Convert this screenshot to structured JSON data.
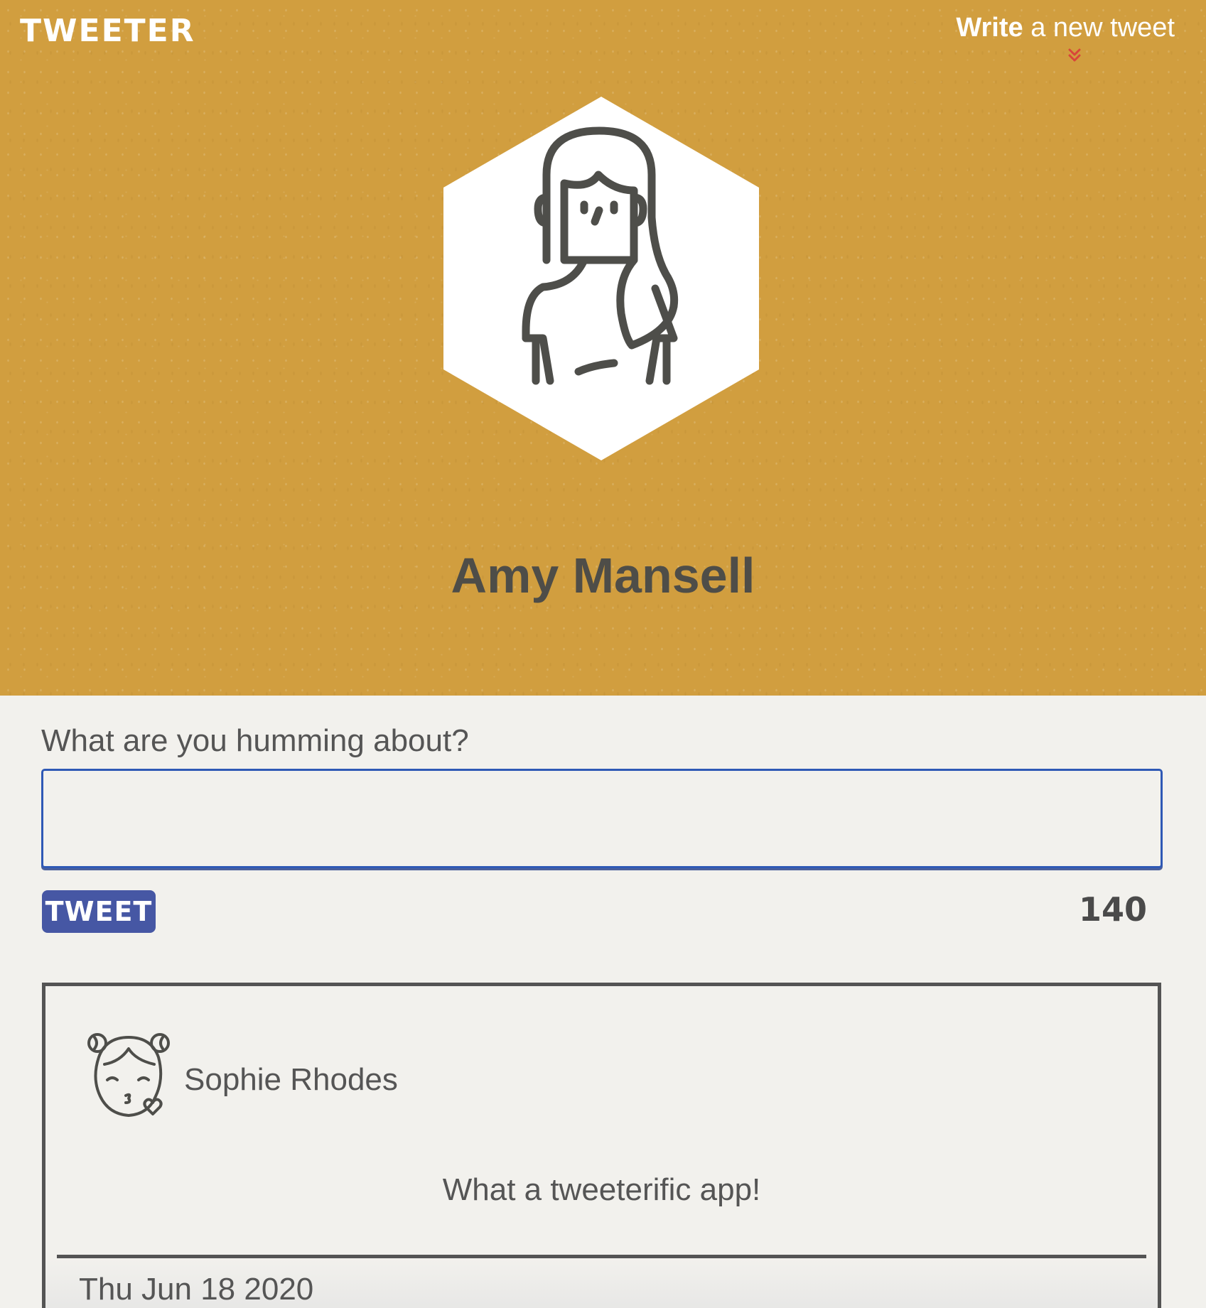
{
  "app": {
    "logo": "TWEETER"
  },
  "nav": {
    "compose_strong": "Write",
    "compose_rest": " a new tweet",
    "compose_icon": "chevron-double-down-icon"
  },
  "profile": {
    "name": "Amy Mansell",
    "avatar_icon": "woman-avatar-icon"
  },
  "compose": {
    "prompt": "What are you humming about?",
    "value": "",
    "button_label": "TWEET",
    "counter": "140"
  },
  "tweets": [
    {
      "author": "Sophie Rhodes",
      "avatar_icon": "girl-kissing-avatar-icon",
      "text": "What a tweeterific app!",
      "date": "Thu Jun 18 2020"
    }
  ],
  "colors": {
    "header_bg": "#d19e3f",
    "page_bg": "#f2f1ed",
    "button_bg": "#4657a4",
    "input_border": "#2f59b5",
    "chevron": "#d9453a",
    "text_dark": "#4a4a4a"
  }
}
